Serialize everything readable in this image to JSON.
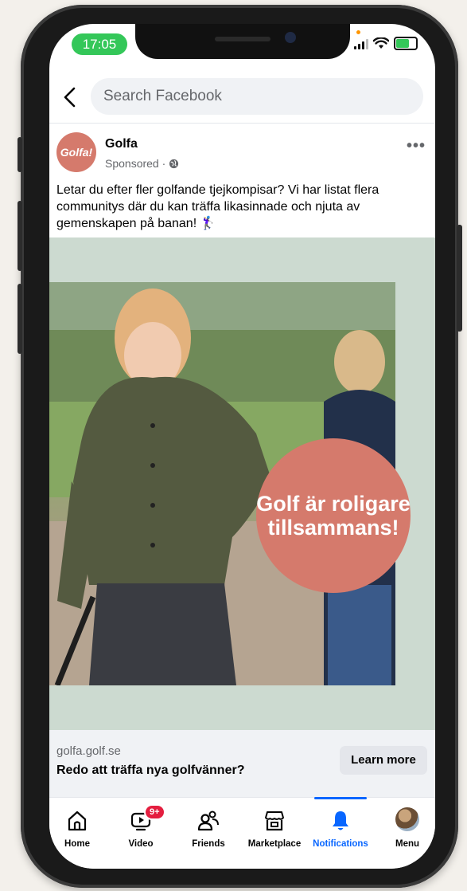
{
  "status_bar": {
    "time": "17:05"
  },
  "search": {
    "placeholder": "Search Facebook"
  },
  "post": {
    "page_name": "Golfa",
    "avatar_text": "Golfa!",
    "sponsored_label": "Sponsored ·",
    "text": "Letar du efter fler golfande tjejkompisar? Vi har listat flera communitys där du kan träffa likasinnade och njuta av gemenskapen på banan! 🏌️‍♀️",
    "image_overlay": "Golf är roligare tillsammans!"
  },
  "cta": {
    "domain": "golfa.golf.se",
    "headline": "Redo att träffa nya golfvänner?",
    "button_label": "Learn more"
  },
  "tabs": [
    {
      "label": "Home",
      "icon": "home-icon"
    },
    {
      "label": "Video",
      "icon": "video-icon",
      "badge": "9+"
    },
    {
      "label": "Friends",
      "icon": "friends-icon"
    },
    {
      "label": "Marketplace",
      "icon": "marketplace-icon"
    },
    {
      "label": "Notifications",
      "icon": "bell-icon",
      "active": true
    },
    {
      "label": "Menu",
      "icon": "profile-avatar"
    }
  ],
  "colors": {
    "brand_blue": "#0866ff",
    "golfa_coral": "#d57a6c",
    "badge_red": "#e41e3f"
  }
}
